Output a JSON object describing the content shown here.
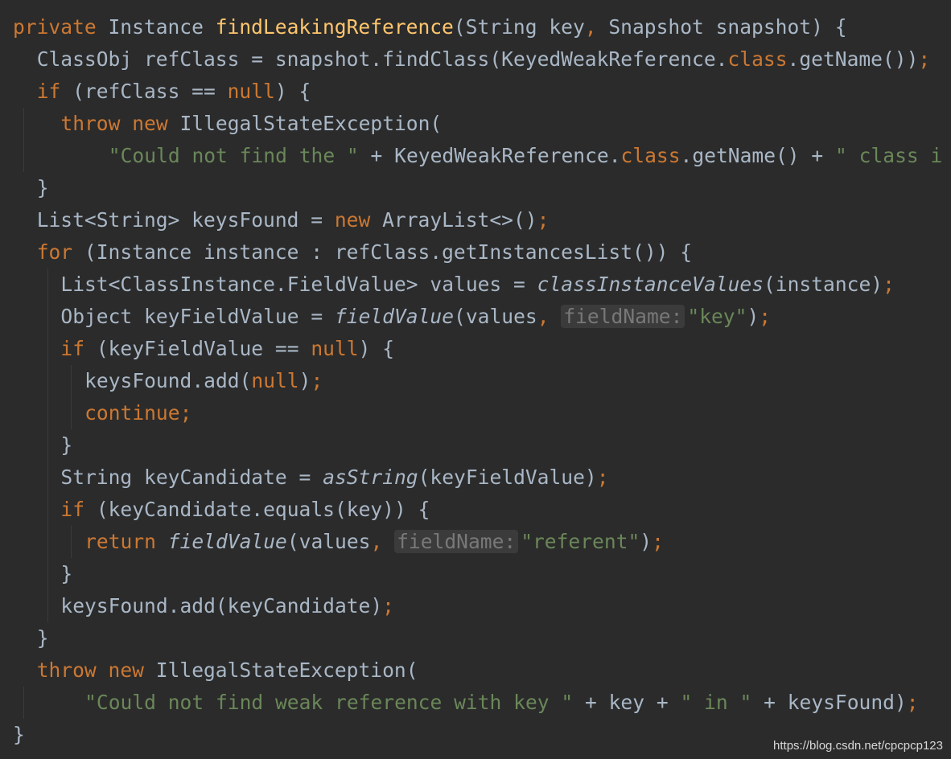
{
  "editor": {
    "theme": "Darcula",
    "colors": {
      "background": "#2b2b2b",
      "plain": "#a9b7c6",
      "keyword": "#cc7832",
      "method_declaration": "#ffc66d",
      "string": "#6a8759",
      "hint_text": "#787878",
      "hint_background": "#3b3b3b"
    },
    "lines": [
      {
        "indent": 0,
        "tokens": [
          {
            "t": "private",
            "k": "kw"
          },
          {
            "t": " Instance ",
            "k": "plain"
          },
          {
            "t": "findLeakingReference",
            "k": "fn"
          },
          {
            "t": "(String key",
            "k": "plain"
          },
          {
            "t": ",",
            "k": "punct"
          },
          {
            "t": " Snapshot snapshot) {",
            "k": "plain"
          }
        ]
      },
      {
        "indent": 1,
        "tokens": [
          {
            "t": "ClassObj refClass = snapshot.findClass(KeyedWeakReference.",
            "k": "plain"
          },
          {
            "t": "class",
            "k": "kw"
          },
          {
            "t": ".getName())",
            "k": "plain"
          },
          {
            "t": ";",
            "k": "punct"
          }
        ]
      },
      {
        "indent": 1,
        "tokens": [
          {
            "t": "if",
            "k": "kw"
          },
          {
            "t": " (refClass == ",
            "k": "plain"
          },
          {
            "t": "null",
            "k": "kw"
          },
          {
            "t": ") {",
            "k": "plain"
          }
        ]
      },
      {
        "indent": 2,
        "tokens": [
          {
            "t": "throw",
            "k": "kw"
          },
          {
            "t": " ",
            "k": "plain"
          },
          {
            "t": "new",
            "k": "kw"
          },
          {
            "t": " IllegalStateException(",
            "k": "plain"
          }
        ]
      },
      {
        "indent": 4,
        "tokens": [
          {
            "t": "\"Could not find the \"",
            "k": "str"
          },
          {
            "t": " + KeyedWeakReference.",
            "k": "plain"
          },
          {
            "t": "class",
            "k": "kw"
          },
          {
            "t": ".getName() + ",
            "k": "plain"
          },
          {
            "t": "\" class i",
            "k": "str"
          }
        ]
      },
      {
        "indent": 1,
        "tokens": [
          {
            "t": "}",
            "k": "plain"
          }
        ]
      },
      {
        "indent": 1,
        "tokens": [
          {
            "t": "List<String> keysFound = ",
            "k": "plain"
          },
          {
            "t": "new",
            "k": "kw"
          },
          {
            "t": " ArrayList<>()",
            "k": "plain"
          },
          {
            "t": ";",
            "k": "punct"
          }
        ]
      },
      {
        "indent": 1,
        "tokens": [
          {
            "t": "for",
            "k": "kw"
          },
          {
            "t": " (Instance instance : refClass.getInstancesList()) {",
            "k": "plain"
          }
        ]
      },
      {
        "indent": 2,
        "tokens": [
          {
            "t": "List<ClassInstance.FieldValue> values = ",
            "k": "plain"
          },
          {
            "t": "classInstanceValues",
            "k": "italic"
          },
          {
            "t": "(instance)",
            "k": "plain"
          },
          {
            "t": ";",
            "k": "punct"
          }
        ]
      },
      {
        "indent": 2,
        "tokens": [
          {
            "t": "Object keyFieldValue = ",
            "k": "plain"
          },
          {
            "t": "fieldValue",
            "k": "italic"
          },
          {
            "t": "(values",
            "k": "plain"
          },
          {
            "t": ",",
            "k": "punct"
          },
          {
            "t": " ",
            "k": "plain"
          },
          {
            "t": "fieldName:",
            "k": "hint"
          },
          {
            "t": "\"key\"",
            "k": "str"
          },
          {
            "t": ")",
            "k": "plain"
          },
          {
            "t": ";",
            "k": "punct"
          }
        ]
      },
      {
        "indent": 2,
        "tokens": [
          {
            "t": "if",
            "k": "kw"
          },
          {
            "t": " (keyFieldValue == ",
            "k": "plain"
          },
          {
            "t": "null",
            "k": "kw"
          },
          {
            "t": ") {",
            "k": "plain"
          }
        ]
      },
      {
        "indent": 3,
        "tokens": [
          {
            "t": "keysFound.add(",
            "k": "plain"
          },
          {
            "t": "null",
            "k": "kw"
          },
          {
            "t": ")",
            "k": "plain"
          },
          {
            "t": ";",
            "k": "punct"
          }
        ]
      },
      {
        "indent": 3,
        "tokens": [
          {
            "t": "continue",
            "k": "kw"
          },
          {
            "t": ";",
            "k": "punct"
          }
        ]
      },
      {
        "indent": 2,
        "tokens": [
          {
            "t": "}",
            "k": "plain"
          }
        ]
      },
      {
        "indent": 2,
        "tokens": [
          {
            "t": "String keyCandidate = ",
            "k": "plain"
          },
          {
            "t": "asString",
            "k": "italic"
          },
          {
            "t": "(keyFieldValue)",
            "k": "plain"
          },
          {
            "t": ";",
            "k": "punct"
          }
        ]
      },
      {
        "indent": 2,
        "tokens": [
          {
            "t": "if",
            "k": "kw"
          },
          {
            "t": " (keyCandidate.equals(key)) {",
            "k": "plain"
          }
        ]
      },
      {
        "indent": 3,
        "tokens": [
          {
            "t": "return",
            "k": "kw"
          },
          {
            "t": " ",
            "k": "plain"
          },
          {
            "t": "fieldValue",
            "k": "italic"
          },
          {
            "t": "(values",
            "k": "plain"
          },
          {
            "t": ",",
            "k": "punct"
          },
          {
            "t": " ",
            "k": "plain"
          },
          {
            "t": "fieldName:",
            "k": "hint"
          },
          {
            "t": "\"referent\"",
            "k": "str"
          },
          {
            "t": ")",
            "k": "plain"
          },
          {
            "t": ";",
            "k": "punct"
          }
        ]
      },
      {
        "indent": 2,
        "tokens": [
          {
            "t": "}",
            "k": "plain"
          }
        ]
      },
      {
        "indent": 2,
        "tokens": [
          {
            "t": "keysFound.add(keyCandidate)",
            "k": "plain"
          },
          {
            "t": ";",
            "k": "punct"
          }
        ]
      },
      {
        "indent": 1,
        "tokens": [
          {
            "t": "}",
            "k": "plain"
          }
        ]
      },
      {
        "indent": 1,
        "tokens": [
          {
            "t": "throw",
            "k": "kw"
          },
          {
            "t": " ",
            "k": "plain"
          },
          {
            "t": "new",
            "k": "kw"
          },
          {
            "t": " IllegalStateException(",
            "k": "plain"
          }
        ]
      },
      {
        "indent": 3,
        "tokens": [
          {
            "t": "\"Could not find weak reference with key \"",
            "k": "str"
          },
          {
            "t": " + key + ",
            "k": "plain"
          },
          {
            "t": "\" in \"",
            "k": "str"
          },
          {
            "t": " + keysFound)",
            "k": "plain"
          },
          {
            "t": ";",
            "k": "punct"
          }
        ]
      },
      {
        "indent": 0,
        "tokens": [
          {
            "t": "}",
            "k": "plain"
          }
        ]
      }
    ]
  },
  "watermark": {
    "text": "https://blog.csdn.net/cpcpcp123"
  }
}
